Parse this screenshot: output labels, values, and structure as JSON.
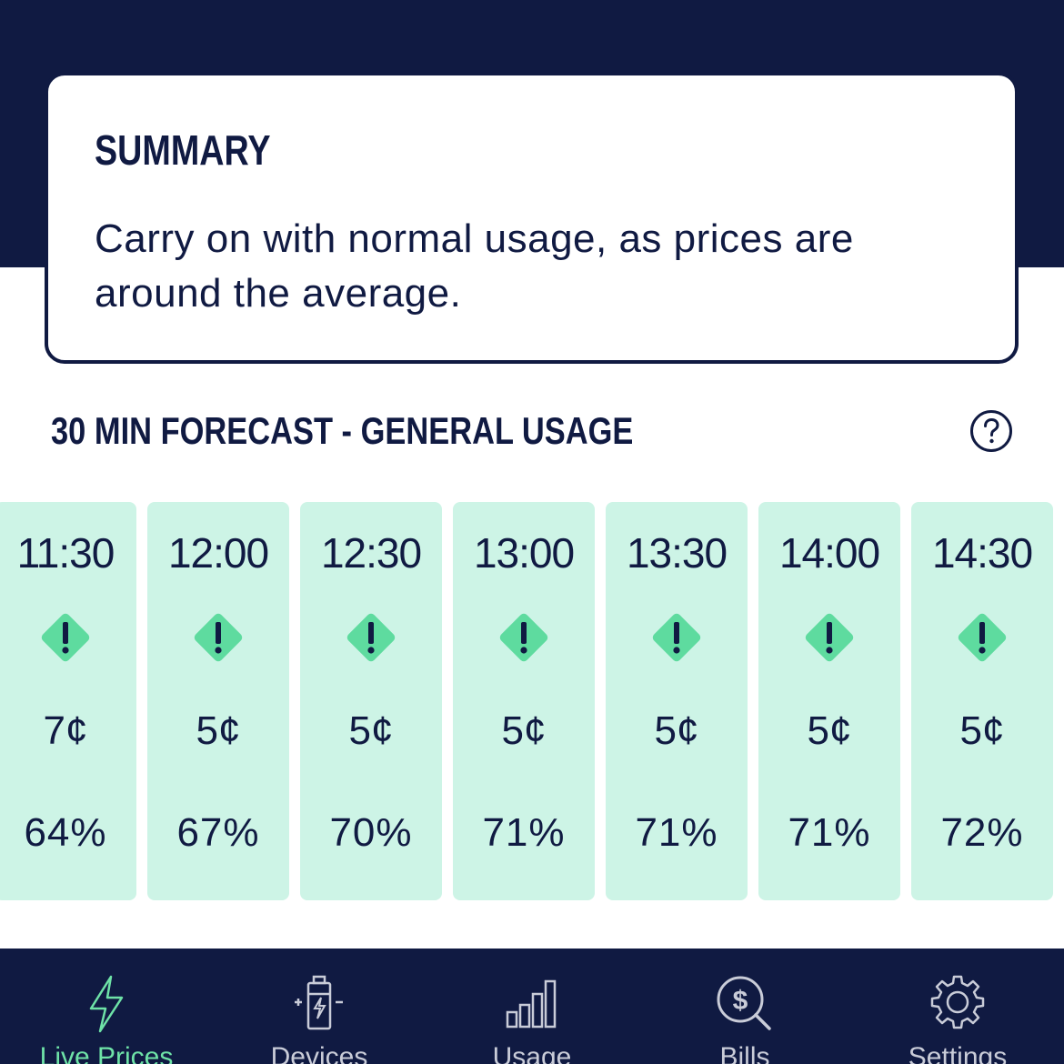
{
  "colors": {
    "navy": "#101a42",
    "card_green": "#cdf4e6",
    "icon_green": "#5edb9f",
    "active_tab": "#6ee2a7",
    "inactive_tab": "#c9ccd8"
  },
  "summary": {
    "title": "SUMMARY",
    "text": "Carry on with normal usage, as prices are around the average."
  },
  "forecast": {
    "heading": "30 MIN FORECAST - GENERAL USAGE",
    "help_icon": "question-circle-icon",
    "items": [
      {
        "time": "11:30",
        "price": "7¢",
        "renewables": "64%",
        "icon": "warning-diamond-icon"
      },
      {
        "time": "12:00",
        "price": "5¢",
        "renewables": "67%",
        "icon": "warning-diamond-icon"
      },
      {
        "time": "12:30",
        "price": "5¢",
        "renewables": "70%",
        "icon": "warning-diamond-icon"
      },
      {
        "time": "13:00",
        "price": "5¢",
        "renewables": "71%",
        "icon": "warning-diamond-icon"
      },
      {
        "time": "13:30",
        "price": "5¢",
        "renewables": "71%",
        "icon": "warning-diamond-icon"
      },
      {
        "time": "14:00",
        "price": "5¢",
        "renewables": "71%",
        "icon": "warning-diamond-icon"
      },
      {
        "time": "14:30",
        "price": "5¢",
        "renewables": "72%",
        "icon": "warning-diamond-icon"
      }
    ]
  },
  "tabbar": {
    "tabs": [
      {
        "label": "Live Prices",
        "icon": "lightning-bolt-icon",
        "active": true
      },
      {
        "label": "Devices",
        "icon": "battery-icon",
        "active": false
      },
      {
        "label": "Usage",
        "icon": "bar-chart-icon",
        "active": false
      },
      {
        "label": "Bills",
        "icon": "dollar-search-icon",
        "active": false
      },
      {
        "label": "Settings",
        "icon": "gear-icon",
        "active": false
      }
    ]
  }
}
